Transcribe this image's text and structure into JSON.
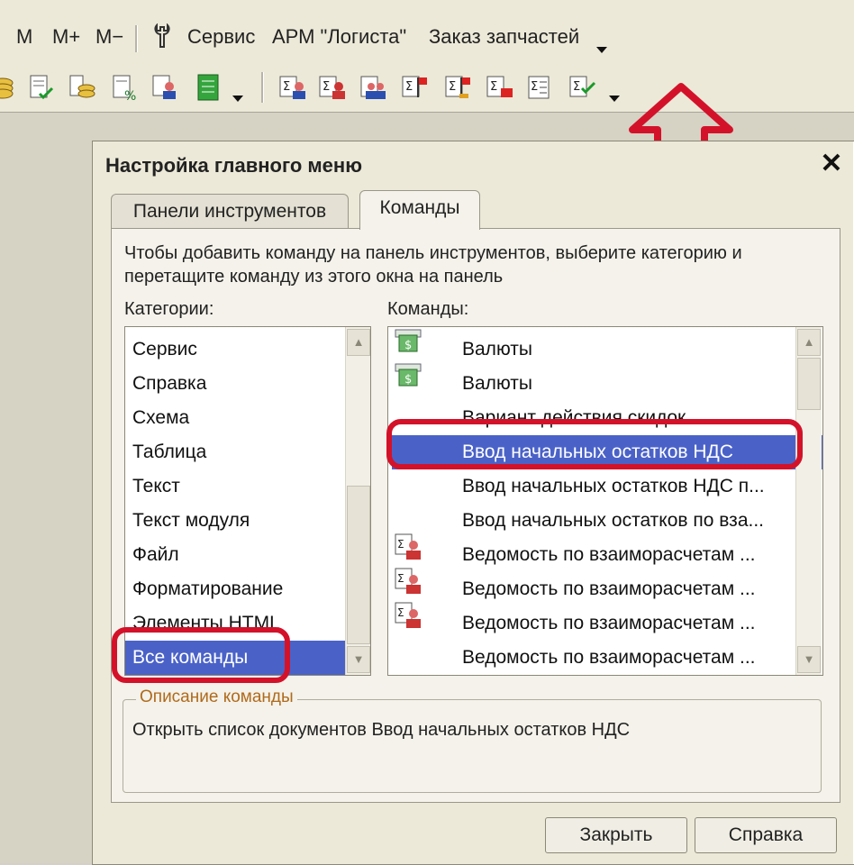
{
  "menubar": {
    "items": [
      "M",
      "M+",
      "M−",
      "Сервис",
      "АРМ \"Логиста\"",
      "Заказ запчастей"
    ],
    "icons": [
      "wrench-icon"
    ]
  },
  "toolbar": {
    "icons": [
      "coins-icon",
      "document-check-icon",
      "coins-stack-icon",
      "document-percent-icon",
      "person-chart-icon",
      "green-table-icon",
      "sigma-person-icon",
      "sigma-person-red-icon",
      "people-icon",
      "sigma-flag-icon",
      "sigma-flag-alt-icon",
      "sigma-folder-icon",
      "sigma-list-icon",
      "sigma-check-icon"
    ]
  },
  "dialog": {
    "title": "Настройка главного меню",
    "tabs": [
      "Панели инструментов",
      "Команды"
    ],
    "hint": "Чтобы добавить команду на панель инструментов, выберите категорию и перетащите команду из этого окна на панель",
    "categories_label": "Категории:",
    "commands_label": "Команды:",
    "categories": [
      "Сервис",
      "Справка",
      "Схема",
      "Таблица",
      "Текст",
      "Текст модуля",
      "Файл",
      "Форматирование",
      "Элементы HTML",
      "Все команды"
    ],
    "selected_category": "Все команды",
    "commands": [
      {
        "label": "Валюты",
        "icon": "currency-icon"
      },
      {
        "label": "Валюты",
        "icon": "currency-icon"
      },
      {
        "label": "Вариант действия скидок",
        "icon": ""
      },
      {
        "label": "Ввод начальных остатков НДС",
        "icon": ""
      },
      {
        "label": "Ввод начальных остатков НДС п...",
        "icon": ""
      },
      {
        "label": "Ввод начальных остатков по вза...",
        "icon": ""
      },
      {
        "label": "Ведомость по взаиморасчетам ...",
        "icon": "sigma-person-icon"
      },
      {
        "label": "Ведомость по взаиморасчетам ...",
        "icon": "sigma-person-icon"
      },
      {
        "label": "Ведомость по взаиморасчетам ...",
        "icon": "sigma-person-icon"
      },
      {
        "label": "Ведомость по взаиморасчетам ...",
        "icon": ""
      }
    ],
    "selected_command": "Ввод начальных остатков НДС",
    "description_label": "Описание команды",
    "description": "Открыть список документов Ввод начальных остатков НДС",
    "buttons": {
      "close": "Закрыть",
      "help": "Справка"
    }
  },
  "annotation_color": "#d3122a",
  "selection_color": "#4a62c8"
}
